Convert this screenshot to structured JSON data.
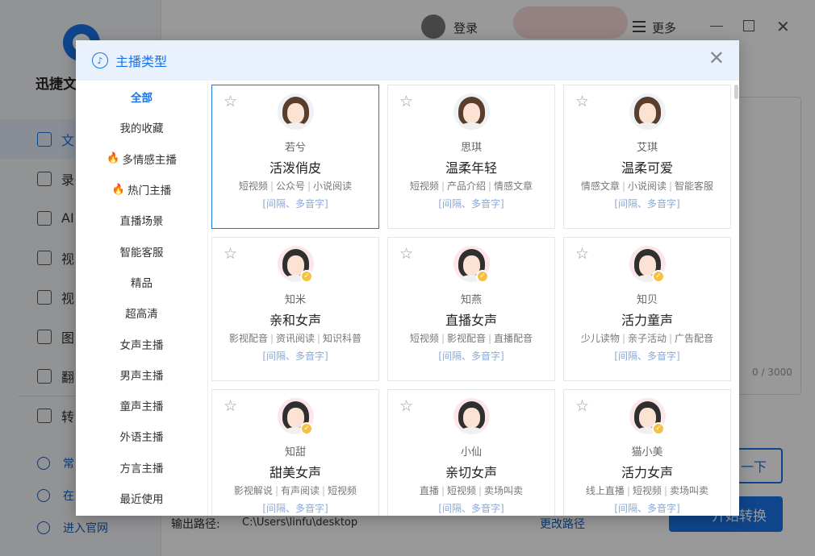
{
  "app": {
    "name": "迅捷文",
    "login_label": "登录",
    "more_label": "更多",
    "nav": [
      {
        "label": "文",
        "active": true
      },
      {
        "label": "录",
        "active": false
      },
      {
        "label": "AI",
        "active": false
      },
      {
        "label": "视",
        "active": false
      },
      {
        "label": "视",
        "active": false
      },
      {
        "label": "图",
        "active": false
      },
      {
        "label": "翻",
        "active": false
      },
      {
        "label": "转",
        "active": false
      }
    ],
    "bottom_links": [
      "常",
      "在",
      "进入官网"
    ],
    "counter": "0 / 3000",
    "next_label": "一下",
    "start_label": "开始转换",
    "output_label": "输出路径:",
    "output_path": "C:\\Users\\linfu\\desktop",
    "change_path_label": "更改路径"
  },
  "modal": {
    "title": "主播类型",
    "categories": [
      {
        "label": "全部",
        "active": true,
        "hot": false
      },
      {
        "label": "我的收藏",
        "active": false,
        "hot": false
      },
      {
        "label": "多情感主播",
        "active": false,
        "hot": true
      },
      {
        "label": "热门主播",
        "active": false,
        "hot": true
      },
      {
        "label": "直播场景",
        "active": false,
        "hot": false
      },
      {
        "label": "智能客服",
        "active": false,
        "hot": false
      },
      {
        "label": "精品",
        "active": false,
        "hot": false
      },
      {
        "label": "超高清",
        "active": false,
        "hot": false
      },
      {
        "label": "女声主播",
        "active": false,
        "hot": false
      },
      {
        "label": "男声主播",
        "active": false,
        "hot": false
      },
      {
        "label": "童声主播",
        "active": false,
        "hot": false
      },
      {
        "label": "外语主播",
        "active": false,
        "hot": false
      },
      {
        "label": "方言主播",
        "active": false,
        "hot": false
      },
      {
        "label": "最近使用",
        "active": false,
        "hot": false
      }
    ],
    "voices": [
      {
        "name": "若兮",
        "type": "活泼俏皮",
        "tags": [
          "短视频",
          "公众号",
          "小说阅读"
        ],
        "features": "[间隔、多音字]",
        "selected": true,
        "vip": false,
        "avatar": "plain"
      },
      {
        "name": "思琪",
        "type": "温柔年轻",
        "tags": [
          "短视频",
          "产品介绍",
          "情感文章"
        ],
        "features": "[间隔、多音字]",
        "selected": false,
        "vip": false,
        "avatar": "plain"
      },
      {
        "name": "艾琪",
        "type": "温柔可爱",
        "tags": [
          "情感文章",
          "小说阅读",
          "智能客服"
        ],
        "features": "[间隔、多音字]",
        "selected": false,
        "vip": false,
        "avatar": "plain"
      },
      {
        "name": "知米",
        "type": "亲和女声",
        "tags": [
          "影视配音",
          "资讯阅读",
          "知识科普"
        ],
        "features": "[间隔、多音字]",
        "selected": false,
        "vip": true,
        "avatar": "pink"
      },
      {
        "name": "知燕",
        "type": "直播女声",
        "tags": [
          "短视频",
          "影视配音",
          "直播配音"
        ],
        "features": "[间隔、多音字]",
        "selected": false,
        "vip": true,
        "avatar": "pink"
      },
      {
        "name": "知贝",
        "type": "活力童声",
        "tags": [
          "少儿读物",
          "亲子活动",
          "广告配音"
        ],
        "features": "[间隔、多音字]",
        "selected": false,
        "vip": true,
        "avatar": "pink"
      },
      {
        "name": "知甜",
        "type": "甜美女声",
        "tags": [
          "影视解说",
          "有声阅读",
          "短视频"
        ],
        "features": "[间隔、多音字]",
        "selected": false,
        "vip": true,
        "avatar": "pink"
      },
      {
        "name": "小仙",
        "type": "亲切女声",
        "tags": [
          "直播",
          "短视频",
          "卖场叫卖"
        ],
        "features": "[间隔、多音字]",
        "selected": false,
        "vip": false,
        "avatar": "pink"
      },
      {
        "name": "猫小美",
        "type": "活力女声",
        "tags": [
          "线上直播",
          "短视频",
          "卖场叫卖"
        ],
        "features": "[间隔、多音字]",
        "selected": false,
        "vip": true,
        "avatar": "pink"
      }
    ]
  },
  "colors": {
    "accent": "#1a73e8",
    "hot": "#ff4d1a",
    "vip": "#f6c143"
  }
}
